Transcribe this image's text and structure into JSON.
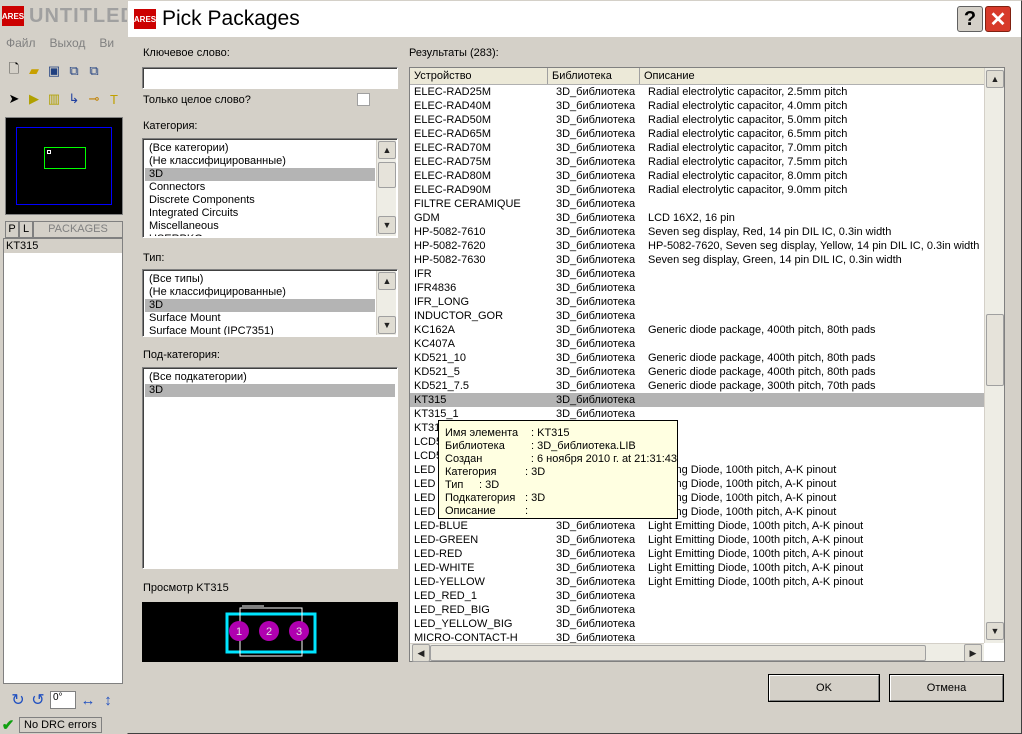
{
  "background_app": {
    "title": "UNTITLED",
    "menu": [
      "Файл",
      "Выход",
      "Ви"
    ],
    "panel_tabs": {
      "p": "P",
      "l": "L",
      "label": "PACKAGES"
    },
    "selected_package": "KT315",
    "angle_value": "0°",
    "status": "No DRC errors"
  },
  "dialog": {
    "title": "Pick Packages",
    "keyword": {
      "label": "Ключевое слово:",
      "value": ""
    },
    "whole_word_label": "Только целое слово?",
    "category": {
      "label": "Категория:",
      "items": [
        "(Все категории)",
        "(Не классифицированные)",
        "3D",
        "Connectors",
        "Discrete Components",
        "Integrated Circuits",
        "Miscellaneous",
        "USERPKG"
      ],
      "selected": 2
    },
    "type": {
      "label": "Тип:",
      "items": [
        "(Все типы)",
        "(Не классифицированные)",
        "3D",
        "Surface Mount",
        "Surface Mount (IPC7351)"
      ],
      "selected": 2
    },
    "subcategory": {
      "label": "Под-категория:",
      "items": [
        "(Все подкатегории)",
        "3D"
      ],
      "selected": 1
    },
    "preview_label": "Просмотр KT315",
    "preview_pins": [
      "1",
      "2",
      "3"
    ],
    "results": {
      "label": "Результаты (283):",
      "columns": [
        "Устройство",
        "Библиотека",
        "Описание"
      ],
      "rows": [
        [
          "ELEC-RAD25M",
          "3D_библиотека",
          "Radial electrolytic capacitor, 2.5mm pitch"
        ],
        [
          "ELEC-RAD40M",
          "3D_библиотека",
          "Radial electrolytic capacitor, 4.0mm pitch"
        ],
        [
          "ELEC-RAD50M",
          "3D_библиотека",
          "Radial electrolytic capacitor, 5.0mm pitch"
        ],
        [
          "ELEC-RAD65M",
          "3D_библиотека",
          "Radial electrolytic capacitor, 6.5mm pitch"
        ],
        [
          "ELEC-RAD70M",
          "3D_библиотека",
          "Radial electrolytic capacitor, 7.0mm pitch"
        ],
        [
          "ELEC-RAD75M",
          "3D_библиотека",
          "Radial electrolytic capacitor, 7.5mm pitch"
        ],
        [
          "ELEC-RAD80M",
          "3D_библиотека",
          "Radial electrolytic capacitor, 8.0mm pitch"
        ],
        [
          "ELEC-RAD90M",
          "3D_библиотека",
          "Radial electrolytic capacitor, 9.0mm pitch"
        ],
        [
          "FILTRE CERAMIQUE",
          "3D_библиотека",
          ""
        ],
        [
          "GDM",
          "3D_библиотека",
          "LCD 16X2, 16 pin"
        ],
        [
          "HP-5082-7610",
          "3D_библиотека",
          "Seven seg display, Red, 14 pin DIL IC, 0.3in width"
        ],
        [
          "HP-5082-7620",
          "3D_библиотека",
          "HP-5082-7620, Seven seg display, Yellow, 14 pin DIL IC, 0.3in width"
        ],
        [
          "HP-5082-7630",
          "3D_библиотека",
          "Seven seg display, Green, 14 pin DIL IC, 0.3in width"
        ],
        [
          "IFR",
          "3D_библиотека",
          ""
        ],
        [
          "IFR4836",
          "3D_библиотека",
          ""
        ],
        [
          "IFR_LONG",
          "3D_библиотека",
          ""
        ],
        [
          "INDUCTOR_GOR",
          "3D_библиотека",
          ""
        ],
        [
          "KC162A",
          "3D_библиотека",
          "Generic diode package, 400th pitch, 80th pads"
        ],
        [
          "KC407A",
          "3D_библиотека",
          ""
        ],
        [
          "KD521_10",
          "3D_библиотека",
          "Generic diode package, 400th pitch, 80th pads"
        ],
        [
          "KD521_5",
          "3D_библиотека",
          "Generic diode package, 400th pitch, 80th pads"
        ],
        [
          "KD521_7.5",
          "3D_библиотека",
          "Generic diode package, 300th pitch, 70th pads"
        ],
        [
          "KT315",
          "3D_библиотека",
          ""
        ],
        [
          "KT315_1",
          "3D_библиотека",
          ""
        ],
        [
          "KT31",
          "",
          ""
        ],
        [
          "LCD5",
          "",
          ""
        ],
        [
          "LCD5",
          "",
          ""
        ],
        [
          "LED",
          "",
          "Emitting Diode, 100th pitch, A-K pinout"
        ],
        [
          "LED",
          "",
          "Emitting Diode, 100th pitch, A-K pinout"
        ],
        [
          "LED",
          "",
          "Emitting Diode, 100th pitch, A-K pinout"
        ],
        [
          "LED",
          "",
          "Emitting Diode, 100th pitch, A-K pinout"
        ],
        [
          "LED-BLUE",
          "3D_библиотека",
          "Light Emitting Diode, 100th pitch, A-K pinout"
        ],
        [
          "LED-GREEN",
          "3D_библиотека",
          "Light Emitting Diode, 100th pitch, A-K pinout"
        ],
        [
          "LED-RED",
          "3D_библиотека",
          "Light Emitting Diode, 100th pitch, A-K pinout"
        ],
        [
          "LED-WHITE",
          "3D_библиотека",
          "Light Emitting Diode, 100th pitch, A-K pinout"
        ],
        [
          "LED-YELLOW",
          "3D_библиотека",
          "Light Emitting Diode, 100th pitch, A-K pinout"
        ],
        [
          "LED_RED_1",
          "3D_библиотека",
          ""
        ],
        [
          "LED_RED_BIG",
          "3D_библиотека",
          ""
        ],
        [
          "LED_YELLOW_BIG",
          "3D_библиотека",
          ""
        ],
        [
          "MICRO-CONTACT-H",
          "3D_библиотека",
          ""
        ]
      ],
      "selected_row": 22
    },
    "tooltip": [
      [
        "Имя элемента",
        ": KT315"
      ],
      [
        "Библиотека",
        ": 3D_библиотека.LIB"
      ],
      [
        "Создан",
        ": 6 ноября 2010 г. at 21:31:43"
      ],
      [
        "Категория",
        ": 3D"
      ],
      [
        "Тип",
        ": 3D"
      ],
      [
        "Подкатегория",
        ": 3D"
      ],
      [
        "Описание",
        ":"
      ]
    ],
    "ok_label": "OK",
    "cancel_label": "Отмена"
  },
  "colors": {
    "brand": "#cc0000",
    "selection": "#b4b4b4",
    "tooltip_bg": "#ffffe1",
    "pad": "#b000b0",
    "outline": "#00e5ff"
  }
}
